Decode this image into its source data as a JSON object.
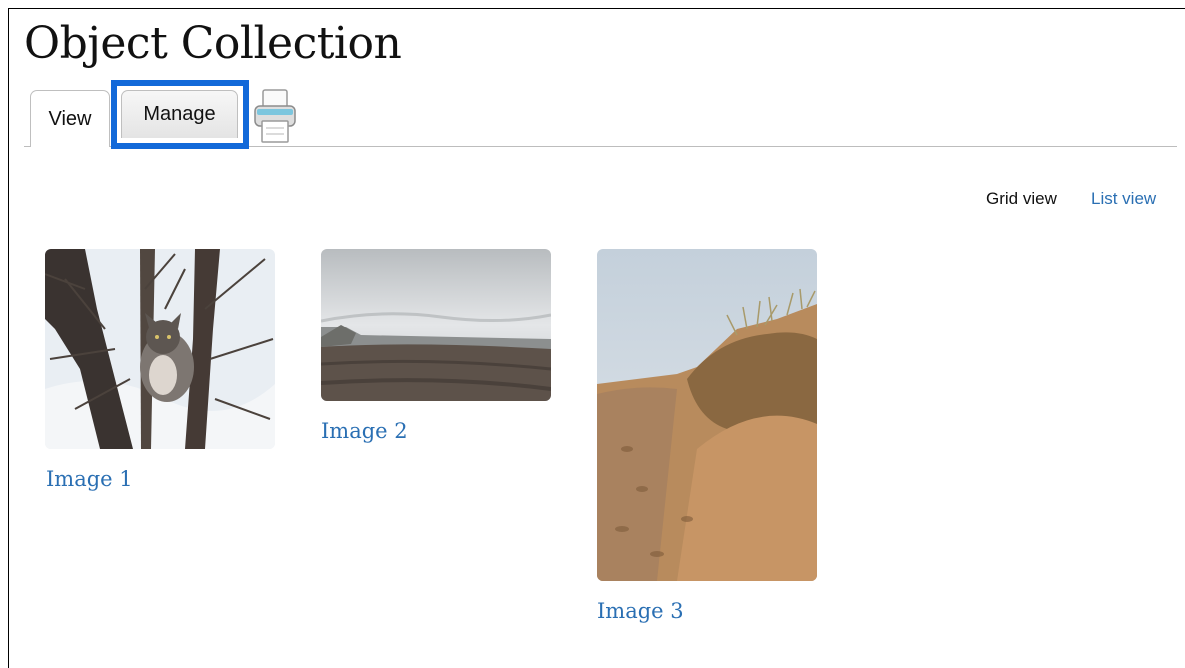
{
  "page": {
    "title": "Object Collection"
  },
  "tabs": [
    {
      "label": "View",
      "active": true
    },
    {
      "label": "Manage",
      "active": false
    }
  ],
  "toolbar": {
    "print_icon": "printer-icon"
  },
  "view_switcher": {
    "grid_label": "Grid view",
    "list_label": "List view"
  },
  "gallery": {
    "items": [
      {
        "title": "Image 1",
        "image": "cat-in-snowy-tree"
      },
      {
        "title": "Image 2",
        "image": "overcast-beach"
      },
      {
        "title": "Image 3",
        "image": "sand-dune"
      }
    ]
  },
  "colors": {
    "link": "#2a6fb3",
    "highlight": "#1269d9"
  }
}
